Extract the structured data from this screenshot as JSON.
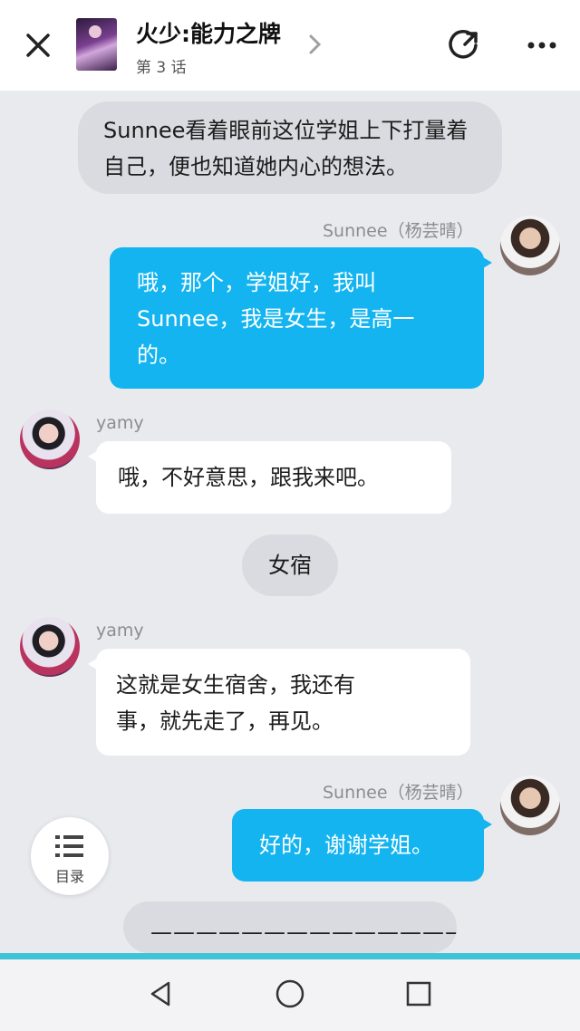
{
  "header": {
    "title": "火少:能力之牌",
    "episode": "第 3 话"
  },
  "messages": {
    "m1": {
      "type": "narration",
      "lines": [
        "Sunnee看着眼前这位学姐上下打量着",
        "自己，便也知道她内心的想法。"
      ]
    },
    "m2": {
      "sender": "Sunnee（杨芸晴）",
      "side": "right",
      "lines": [
        "哦，那个，学姐好，我叫",
        "Sunnee，我是女生，是高一",
        "的。"
      ]
    },
    "m3": {
      "sender": "yamy",
      "side": "left",
      "lines": [
        "哦，不好意思，跟我来吧。"
      ]
    },
    "m4": {
      "type": "narration",
      "lines": [
        "女宿"
      ]
    },
    "m5": {
      "sender": "yamy",
      "side": "left",
      "lines": [
        "这就是女生宿舍，我还有",
        "事，就先走了，再见。"
      ]
    },
    "m6": {
      "sender": "Sunnee（杨芸晴）",
      "side": "right",
      "lines": [
        "好的，谢谢学姐。"
      ]
    },
    "m7": {
      "type": "narration",
      "lines": [
        "——————————————"
      ]
    }
  },
  "catalog": {
    "label": "目录"
  },
  "colors": {
    "accent": "#13b4f0",
    "line": "#3fc3d6"
  },
  "icons": [
    "close-icon",
    "chevron-right-icon",
    "share-icon",
    "more-icon",
    "list-icon",
    "back-icon",
    "home-icon",
    "recents-icon"
  ]
}
